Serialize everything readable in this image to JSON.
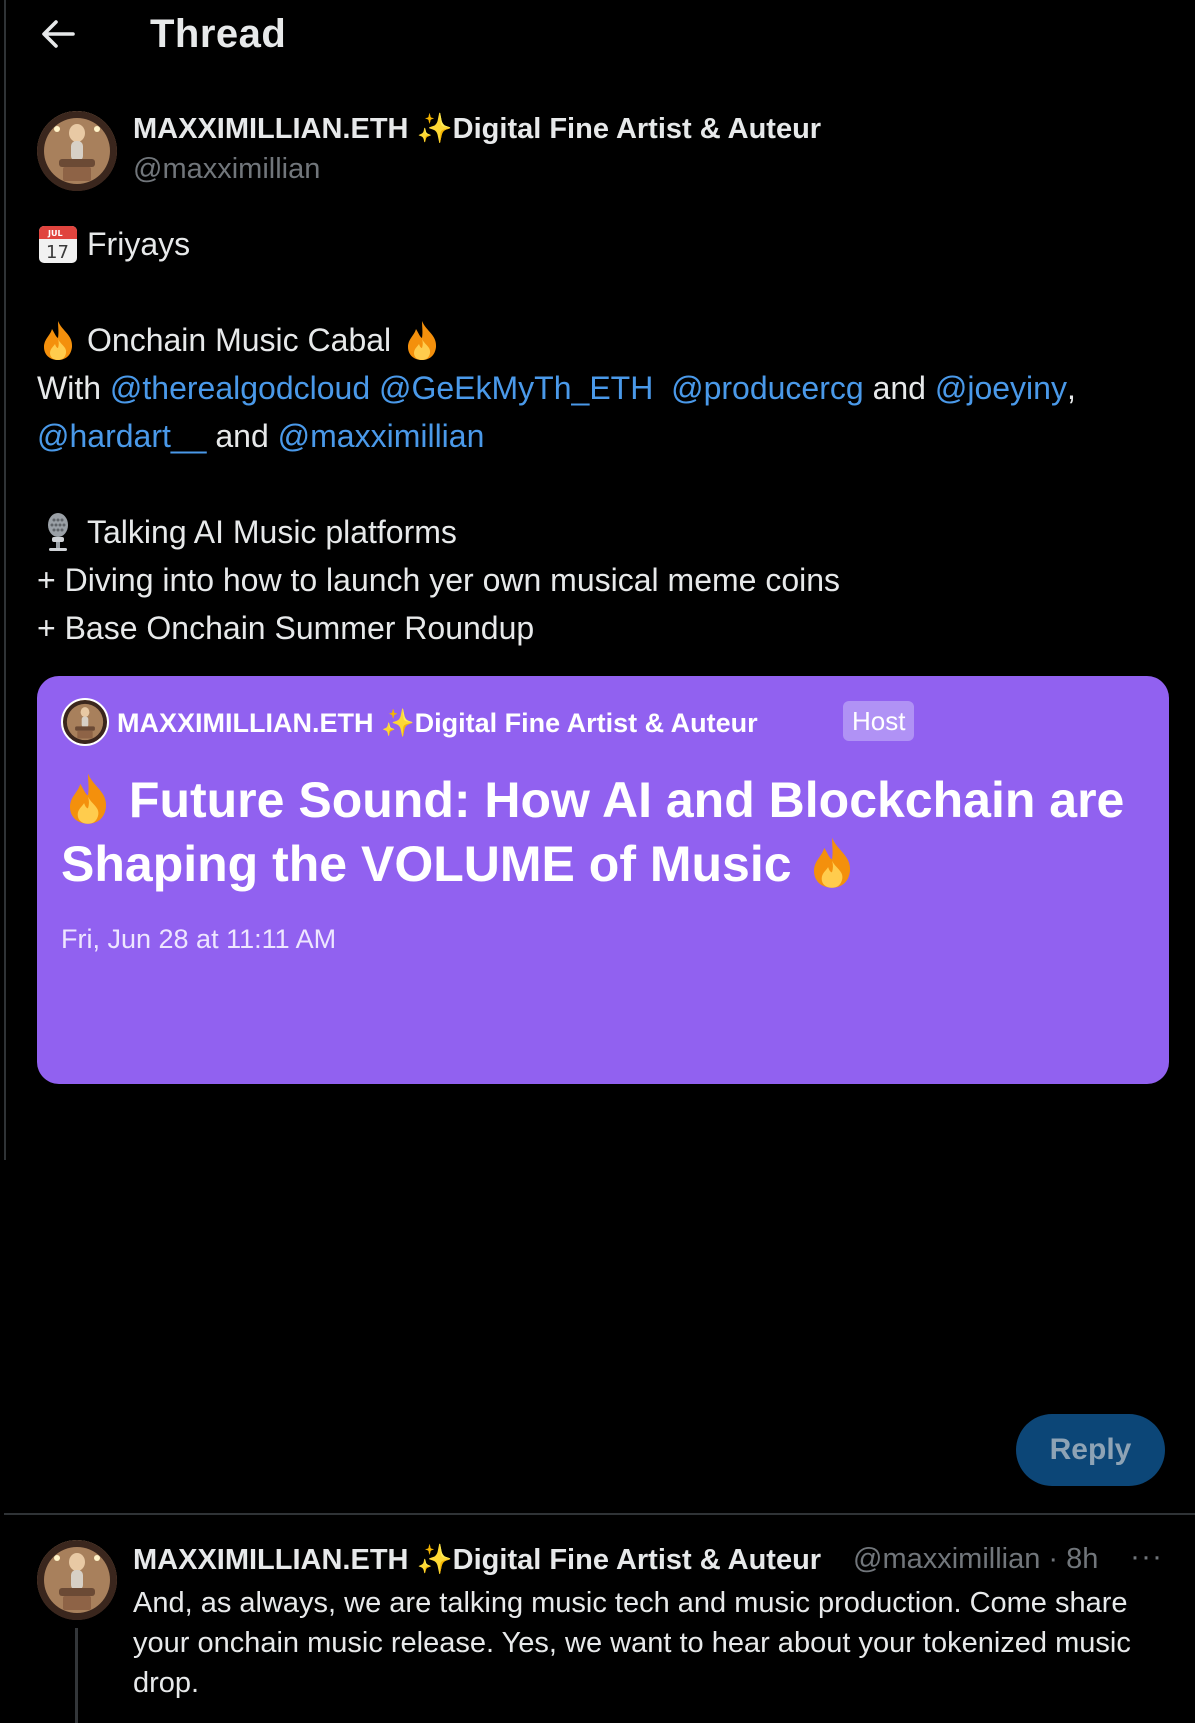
{
  "header": {
    "title": "Thread",
    "back_icon": "arrow-left-icon"
  },
  "post": {
    "author_name": "MAXXIMILLIAN.ETH",
    "author_sparkle": "✨",
    "author_title": "Digital Fine Artist & Auteur",
    "handle": "@maxximillian",
    "line1_text": "Friyays",
    "line2_text": "Onchain Music Cabal",
    "line3_prefix": "With",
    "mentions": [
      "@therealgodcloud",
      "@GeEkMyTh_ETH",
      "@producercg",
      "@joeyiny",
      "@hardart__",
      "@maxximillian"
    ],
    "and_word": "and",
    "comma": ",",
    "line5_text": "Talking AI Music platforms",
    "line6_text": "+ Diving into how to launch yer own musical meme coins",
    "line7_text": "+ Base Onchain Summer Roundup"
  },
  "space_card": {
    "host_name": "MAXXIMILLIAN.ETH",
    "host_sparkle": "✨",
    "host_title": "Digital Fine Artist & Auteur",
    "host_badge": "Host",
    "title": "Future Sound: How AI and Blockchain are Shaping the VOLUME of Music",
    "date": "Fri, Jun 28 at 11:11 AM",
    "background_color": "#9161f0"
  },
  "reply_button": {
    "label": "Reply",
    "color": "#0c4677"
  },
  "reply": {
    "author_name": "MAXXIMILLIAN.ETH",
    "author_sparkle": "✨",
    "author_title": "Digital Fine Artist & Auteur",
    "handle": "@maxximillian",
    "time": "· 8h",
    "more": "···",
    "text": "And, as always, we are talking music tech and music  production. Come share your onchain music release. Yes, we want to hear about your tokenized music drop."
  },
  "calendar_icon": {
    "month": "JUL",
    "day": "17"
  },
  "colors": {
    "background": "#000000",
    "text": "#e7e9ea",
    "secondary": "#71767b",
    "link": "#4a99e9"
  }
}
